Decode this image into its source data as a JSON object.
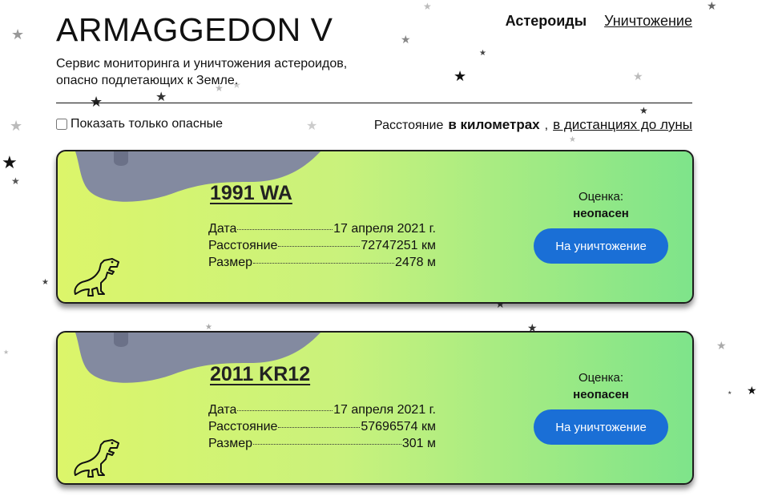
{
  "header": {
    "title": "ARMAGGEDON V",
    "subtitle": "Сервис мониторинга и уничтожения астероидов, опасно подлетающих к Земле.",
    "nav": {
      "current": "Астероиды",
      "link": "Уничтожение"
    }
  },
  "controls": {
    "filter_label": "Показать только опасные",
    "filter_checked": false,
    "distance_label": "Расстояние",
    "unit_active": "в километрах",
    "unit_separator": ",",
    "unit_link": "в дистанциях до луны"
  },
  "asteroids": [
    {
      "name": "1991 WA",
      "date_label": "Дата",
      "date": "17 апреля 2021 г.",
      "distance_label": "Расстояние",
      "distance": "72747251 км",
      "size_label": "Размер",
      "size": "2478 м",
      "rating_label": "Оценка:",
      "rating": "неопасен",
      "button_label": "На уничтожение"
    },
    {
      "name": "2011 KR12",
      "date_label": "Дата",
      "date": "17 апреля 2021 г.",
      "distance_label": "Расстояние",
      "distance": "57696574 км",
      "size_label": "Размер",
      "size": "301 м",
      "rating_label": "Оценка:",
      "rating": "неопасен",
      "button_label": "На уничтожение"
    }
  ],
  "colors": {
    "button": "#1a6fd6",
    "card_gradient_start": "#dcf56a",
    "card_gradient_end": "#7ee48a",
    "asteroid_blob": "#838aa0"
  },
  "icons": [
    "star-icon",
    "asteroid-icon",
    "dinosaur-icon",
    "checkbox-icon"
  ]
}
